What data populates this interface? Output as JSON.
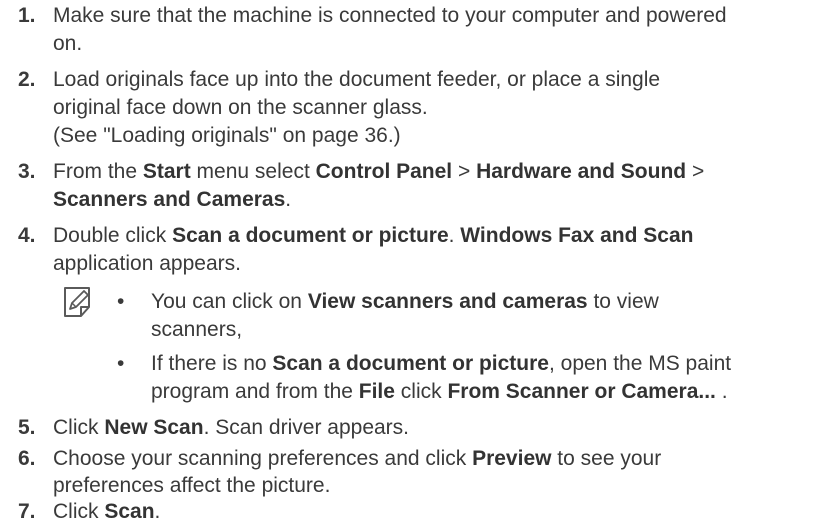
{
  "steps": [
    {
      "num": "1.",
      "line1": "Make sure that the machine is connected to your computer and powered",
      "line2": "on."
    },
    {
      "num": "2.",
      "line1": "Load originals face up into the document feeder, or place a single",
      "line2": "original face down on the scanner glass.",
      "line3": "(See \"Loading originals\" on page 36.)"
    },
    {
      "num": "3.",
      "p1": "From the ",
      "b1": "Start",
      "p2": " menu select ",
      "b2": "Control Panel",
      "p3": " > ",
      "b3": "Hardware and Sound",
      "p4": " >",
      "b4": "Scanners and Cameras",
      "p5": "."
    },
    {
      "num": "4.",
      "p1": "Double click ",
      "b1": "Scan a document or picture",
      "p2": ". ",
      "b2": "Windows Fax and Scan",
      "line2": "application appears."
    },
    {
      "num": "5.",
      "p1": "Click ",
      "b1": "New Scan",
      "p2": ". Scan driver appears."
    },
    {
      "num": "6.",
      "p1": "Choose your scanning preferences and click ",
      "b1": "Preview",
      "p2": " to see your",
      "line2": "preferences affect the picture."
    },
    {
      "num": "7.",
      "p1": "Click ",
      "b1": "Scan",
      "p2": "."
    }
  ],
  "note": {
    "bullet": "•",
    "items": [
      {
        "p1": "You can click on ",
        "b1": "View scanners and cameras",
        "p2": " to view",
        "line2": "scanners,"
      },
      {
        "p1": "If there is no ",
        "b1": "Scan a document or picture",
        "p2": ", open the MS paint",
        "p3": "program and from the ",
        "b2": "File",
        "p4": " click ",
        "b3": "From Scanner or Camera...",
        "p5": " ."
      }
    ]
  }
}
